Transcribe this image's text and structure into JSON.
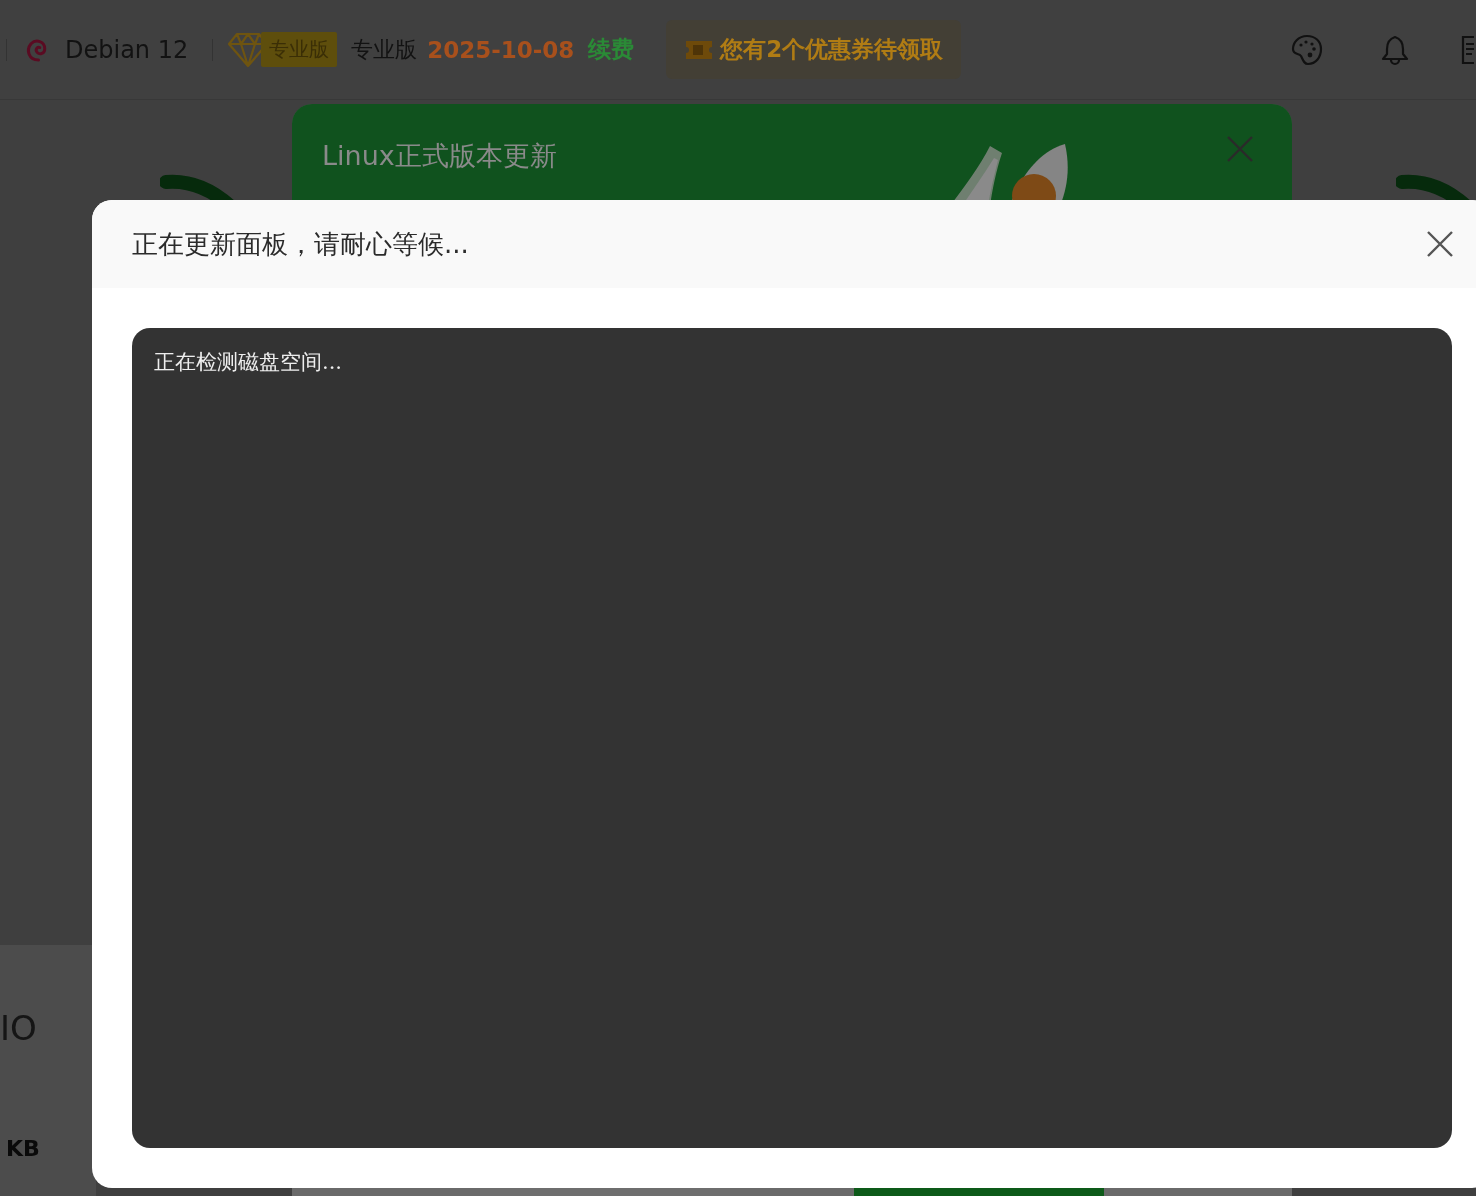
{
  "topbar": {
    "os": "Debian 12",
    "edition_badge": "专业版",
    "edition": "专业版",
    "expiry": "2025-10-08",
    "renew": "续费",
    "coupon": "您有2个优惠券待领取"
  },
  "background": {
    "labels": [
      "IO",
      "KB"
    ]
  },
  "update_notice": {
    "title": "Linux正式版本更新"
  },
  "dialog": {
    "title": "正在更新面板，请耐心等候...",
    "log": "正在检测磁盘空间..."
  }
}
